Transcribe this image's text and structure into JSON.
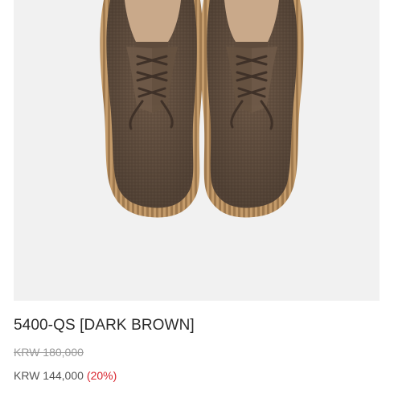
{
  "product": {
    "image_alt": "Dark brown suede lace-up derby shoes viewed from above",
    "name": "5400-QS [DARK BROWN]",
    "original_price": "KRW 180,000",
    "sale_price": "KRW 144,000",
    "discount": "(20%)"
  },
  "colors": {
    "background": "#ffffff",
    "image_background": "#f1f1f1",
    "suede": "#6b5645",
    "sole": "#b08a5e",
    "discount": "#d9232d"
  }
}
